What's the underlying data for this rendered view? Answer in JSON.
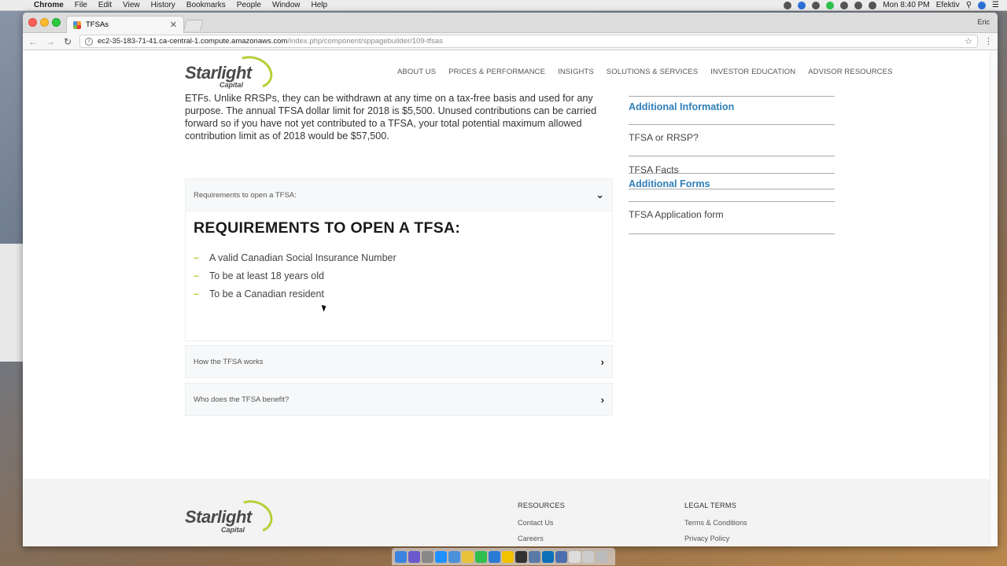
{
  "menubar": {
    "app": "Chrome",
    "items": [
      "File",
      "Edit",
      "View",
      "History",
      "Bookmarks",
      "People",
      "Window",
      "Help"
    ],
    "clock": "Mon 8:40 PM",
    "user": "Efektiv"
  },
  "browser": {
    "tab_title": "TFSAs",
    "profile": "Eric",
    "url_host": "ec2-35-183-71-41.ca-central-1.compute.amazonaws.com",
    "url_path": "/index.php/component/sppagebuilder/109-tfsas"
  },
  "header": {
    "logo_word": "Starlight",
    "logo_sub": "Capital",
    "nav": [
      "ABOUT US",
      "PRICES & PERFORMANCE",
      "INSIGHTS",
      "SOLUTIONS & SERVICES",
      "INVESTOR EDUCATION",
      "ADVISOR RESOURCES"
    ]
  },
  "article": {
    "intro": "ETFs. Unlike RRSPs, they can be withdrawn at any time on a tax-free basis and used for any purpose. The annual TFSA dollar limit for 2018 is $5,500. Unused contributions can be carried forward so if you have not yet contributed to a TFSA, your total potential maximum allowed contribution limit as of 2018 would be $57,500."
  },
  "accordion": {
    "items": [
      {
        "label": "Requirements to open a TFSA:",
        "title": "REQUIREMENTS TO OPEN A TFSA:",
        "bullets": [
          "A valid Canadian Social Insurance Number",
          "To be at least 18 years old",
          "To be a Canadian resident"
        ]
      },
      {
        "label": "How the TFSA works"
      },
      {
        "label": "Who does the TFSA benefit?"
      }
    ]
  },
  "sidebar": {
    "heading_info": "Additional Information",
    "link_rrsp": "TFSA or RRSP?",
    "link_facts": "TFSA Facts",
    "heading_forms": "Additional Forms",
    "link_form": "TFSA Application form"
  },
  "footer": {
    "resources_title": "RESOURCES",
    "resources_links": [
      "Contact Us",
      "Careers"
    ],
    "legal_title": "LEGAL TERMS",
    "legal_links": [
      "Terms & Conditions",
      "Privacy Policy"
    ]
  },
  "colors": {
    "accent_green": "#b6cf37",
    "link_blue": "#2e7fb8"
  }
}
